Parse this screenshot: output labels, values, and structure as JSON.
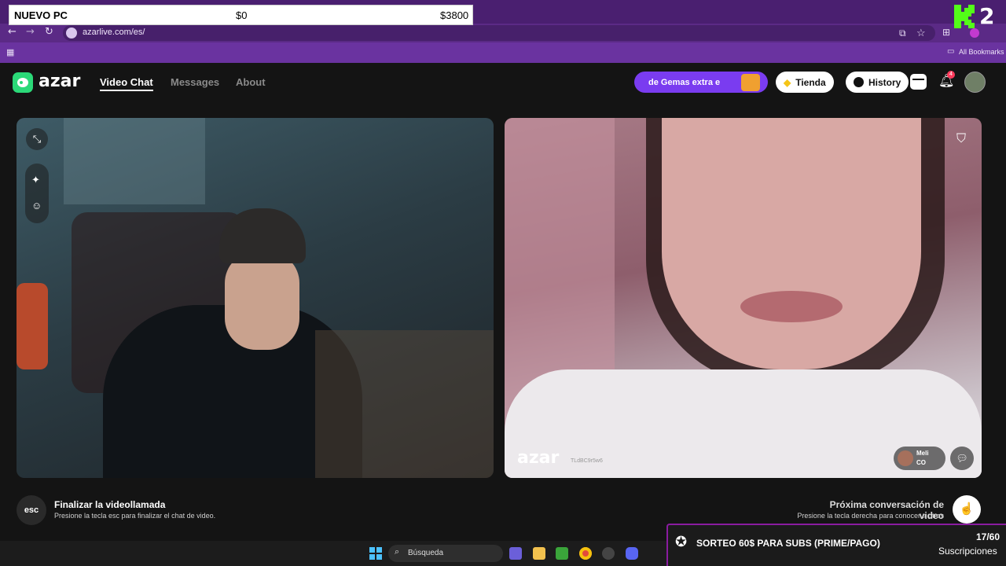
{
  "overlay": {
    "label": "NUEVO PC",
    "current": "$0",
    "goal": "$3800"
  },
  "stream_badge": {
    "number": "2"
  },
  "browser": {
    "url": "azarlive.com/es/",
    "bookmarks_label": "All Bookmarks"
  },
  "header": {
    "logo_text": "azar",
    "nav": [
      "Video Chat",
      "Messages",
      "About"
    ],
    "gems_text": "de Gemas extra e",
    "store_label": "Tienda",
    "history_label": "History",
    "notification_count": "4"
  },
  "remote_video": {
    "watermark": "azar",
    "watermark_id": "TLdBC9r5w6",
    "user_name": "Meli",
    "user_country": "CO"
  },
  "bottom": {
    "esc_key": "esc",
    "end_title": "Finalizar la videollamada",
    "end_desc": "Presione la tecla esc para finalizar el chat de video.",
    "next_title": "Próxima conversación de video",
    "next_desc": "Presione la tecla derecha para conocer a otros"
  },
  "taskbar": {
    "search_placeholder": "Búsqueda"
  },
  "sub_goal": {
    "text": "SORTEO 60$ PARA SUBS (PRIME/PAGO)",
    "count": "17/60",
    "label": "Suscripciones"
  },
  "colors": {
    "accent_purple": "#7a3cf0",
    "chrome_purple": "#5b2a86",
    "sub_border": "#8a1ca0"
  }
}
